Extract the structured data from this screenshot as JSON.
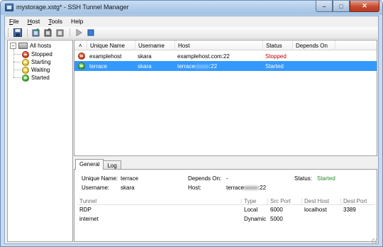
{
  "window": {
    "title": "mystorage.xstg* - SSH Tunnel Manager",
    "minimize_glyph": "–",
    "maximize_glyph": "□",
    "close_glyph": "✕"
  },
  "menu": {
    "file": {
      "ul": "F",
      "rest": "ile"
    },
    "host": {
      "ul": "H",
      "rest": "ost"
    },
    "tools": {
      "ul": "T",
      "rest": "ools"
    },
    "help": {
      "ul": "",
      "rest": "Help"
    }
  },
  "toolbar": {
    "icons": [
      "save-icon",
      "add-host-icon",
      "edit-host-icon",
      "delete-host-icon",
      "start-icon",
      "stop-icon"
    ]
  },
  "tree": {
    "expander": "−",
    "root": "All hosts",
    "nodes": [
      {
        "label": "Stopped",
        "color": "#d83a14"
      },
      {
        "label": "Starting",
        "color": "#e8c014"
      },
      {
        "label": "Waiting",
        "color": "#e8c014"
      },
      {
        "label": "Started",
        "color": "#3cae29"
      }
    ]
  },
  "hosts": {
    "sort_indicator": "˄",
    "columns": {
      "name": "Unique Name",
      "username": "Username",
      "host": "Host",
      "status": "Status",
      "depends_on": "Depends On"
    },
    "rows": [
      {
        "name": "examplehost",
        "username": "skara",
        "host": "examplehost.com:22",
        "status": "Stopped",
        "depends_on": "",
        "selected": false
      },
      {
        "name": "terrace",
        "username": "skara",
        "host_prefix": "terrace",
        "host_blurred": "xxxxx",
        "host_suffix": ":22",
        "status": "Started",
        "depends_on": "",
        "selected": true
      }
    ]
  },
  "details": {
    "tabs": [
      "General",
      "Log"
    ],
    "unique_name_label": "Unique Name:",
    "unique_name": "terrace",
    "depends_on_label": "Depends On:",
    "depends_on": "-",
    "status_label": "Status:",
    "status": "Started",
    "username_label": "Username:",
    "username": "skara",
    "host_label": "Host:",
    "host_prefix": "terrace",
    "host_blurred": "xxxxx",
    "host_suffix": ":22",
    "tunnels": {
      "columns": {
        "tunnel": "Tunnel",
        "type": "Type",
        "src_port": "Src Port",
        "dest_host": "Dest Host",
        "dest_port": "Dest Port"
      },
      "rows": [
        {
          "tunnel": "RDP",
          "type": "Local",
          "src_port": "6000",
          "dest_host": "localhost",
          "dest_port": "3389"
        },
        {
          "tunnel": "internet",
          "type": "Dynamic",
          "src_port": "5000",
          "dest_host": "",
          "dest_port": ""
        }
      ]
    }
  }
}
